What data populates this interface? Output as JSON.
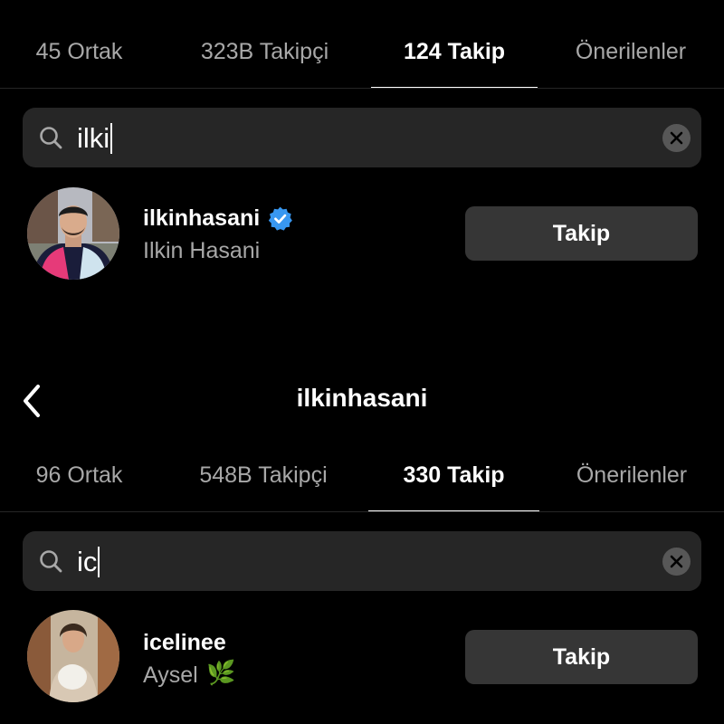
{
  "panel1": {
    "tabs": [
      {
        "label": "45 Ortak",
        "active": false
      },
      {
        "label": "323B Takipçi",
        "active": false
      },
      {
        "label": "124 Takip",
        "active": true
      },
      {
        "label": "Önerilenler",
        "active": false
      }
    ],
    "search": {
      "value": "ilki"
    },
    "result": {
      "username": "ilkinhasani",
      "full_name": "Ilkin Hasani",
      "verified": true,
      "button_label": "Takip"
    }
  },
  "panel2": {
    "header": {
      "title": "ilkinhasani",
      "back_icon": "chevron-left-icon"
    },
    "tabs": [
      {
        "label": "96 Ortak",
        "active": false
      },
      {
        "label": "548B Takipçi",
        "active": false
      },
      {
        "label": "330 Takip",
        "active": true
      },
      {
        "label": "Önerilenler",
        "active": false
      }
    ],
    "search": {
      "value": "ic"
    },
    "result": {
      "username": "icelinee",
      "full_name": "Aysel",
      "emoji": "🌿",
      "button_label": "Takip"
    }
  },
  "colors": {
    "background": "#000000",
    "search_bg": "#262626",
    "button_bg": "#363636",
    "secondary_text": "#a8a8a8",
    "verified_blue": "#3897f0"
  }
}
